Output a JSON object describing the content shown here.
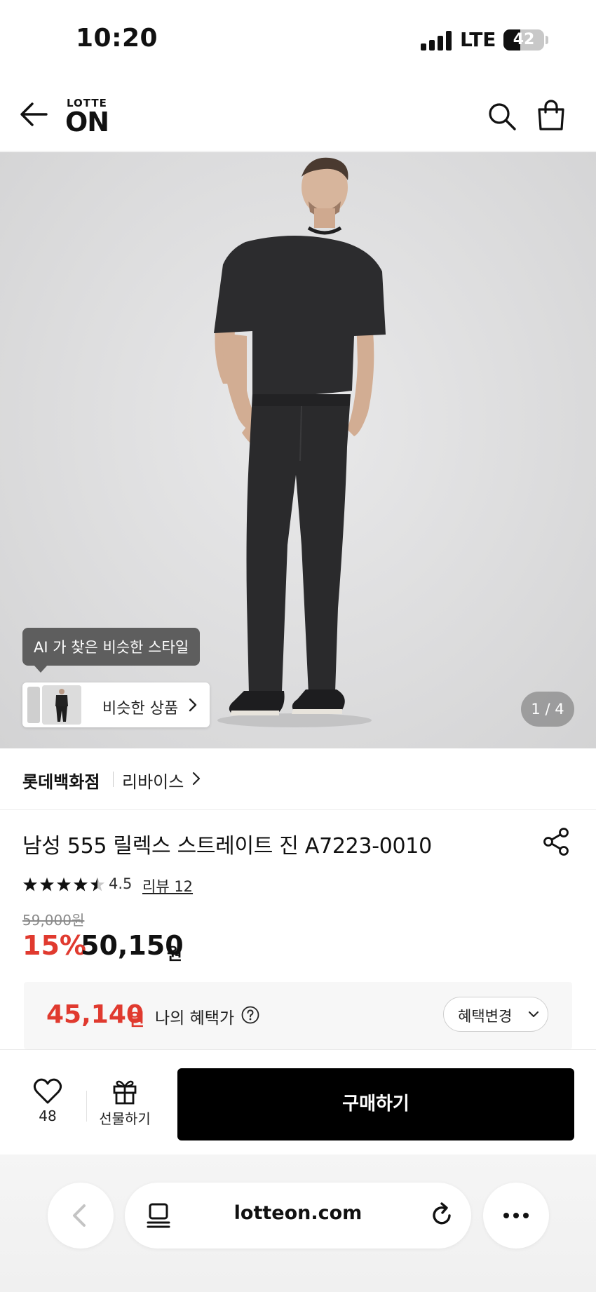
{
  "status_bar": {
    "time": "10:20",
    "network": "LTE",
    "battery": "42",
    "battery_level": 0.42
  },
  "header": {
    "logo_small": "LOTTE",
    "logo_big": "ON"
  },
  "hero": {
    "ai_tooltip": "AI 가 찾은 비슷한 스타일",
    "similar_label": "비슷한 상품",
    "pager": "1 / 4"
  },
  "brand": {
    "store": "롯데백화점",
    "name": "리바이스"
  },
  "product": {
    "title": "남성 555 릴렉스 스트레이트 진 A7223-0010",
    "rating": "4.5",
    "rating_value": 4.5,
    "review": "리뷰 12",
    "original_price": "59,000원",
    "discount": "15%",
    "price": "50,150",
    "price_unit": "원"
  },
  "benefit": {
    "price": "45,140",
    "unit": "원",
    "label": "나의 혜택가",
    "change_label": "혜택변경"
  },
  "buy_bar": {
    "wish_count": "48",
    "gift_label": "선물하기",
    "buy_label": "구매하기"
  },
  "browser": {
    "url": "lotteon.com"
  },
  "colors": {
    "accent_red": "#e03a2f",
    "buy_button": "#000000"
  }
}
